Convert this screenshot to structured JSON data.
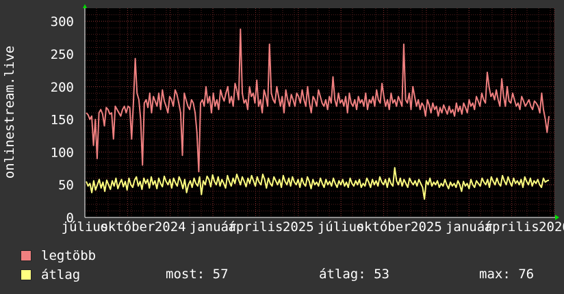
{
  "chart_data": {
    "type": "line",
    "ylabel": "onlinestream.live",
    "ylim": [
      0,
      320
    ],
    "yticks": [
      "0",
      "50",
      "100",
      "150",
      "200",
      "250",
      "300"
    ],
    "xticks": [
      "július",
      "október",
      "2024",
      "január",
      "április",
      "2025",
      "július",
      "október",
      "2025",
      "január",
      "április",
      "2026"
    ],
    "grid": true,
    "legend_placement": "bottom",
    "series": [
      {
        "name": "legtöbb",
        "color": "#f08080",
        "values": [
          160,
          157,
          150,
          155,
          110,
          150,
          90,
          160,
          165,
          158,
          140,
          168,
          165,
          158,
          160,
          120,
          170,
          165,
          160,
          155,
          165,
          170,
          160,
          170,
          168,
          120,
          175,
          243,
          190,
          180,
          150,
          80,
          175,
          180,
          168,
          190,
          160,
          185,
          178,
          170,
          190,
          165,
          195,
          178,
          170,
          160,
          185,
          180,
          170,
          195,
          188,
          175,
          160,
          95,
          190,
          180,
          170,
          165,
          180,
          175,
          160,
          130,
          70,
          175,
          180,
          170,
          200,
          175,
          185,
          160,
          190,
          170,
          180,
          165,
          195,
          185,
          178,
          190,
          200,
          175,
          185,
          170,
          205,
          195,
          180,
          288,
          190,
          175,
          180,
          165,
          200,
          185,
          190,
          175,
          210,
          170,
          180,
          160,
          195,
          185,
          170,
          265,
          190,
          180,
          175,
          200,
          185,
          170,
          185,
          160,
          195,
          180,
          170,
          188,
          180,
          170,
          190,
          185,
          175,
          195,
          180,
          170,
          200,
          175,
          160,
          185,
          180,
          170,
          195,
          185,
          175,
          170,
          180,
          165,
          185,
          175,
          215,
          180,
          170,
          190,
          175,
          180,
          170,
          185,
          160,
          190,
          175,
          170,
          180,
          165,
          185,
          175,
          180,
          170,
          190,
          165,
          180,
          175,
          185,
          170,
          195,
          180,
          175,
          205,
          185,
          170,
          180,
          165,
          190,
          175,
          180,
          170,
          185,
          178,
          170,
          265,
          180,
          175,
          190,
          165,
          200,
          185,
          170,
          180,
          165,
          175,
          170,
          155,
          180,
          172,
          160,
          175,
          165,
          170,
          155,
          168,
          160,
          172,
          165,
          158,
          170,
          160,
          165,
          155,
          175,
          162,
          170,
          158,
          175,
          168,
          160,
          180,
          170,
          175,
          165,
          185,
          178,
          170,
          190,
          180,
          175,
          222,
          200,
          185,
          190,
          180,
          195,
          180,
          170,
          212,
          185,
          170,
          200,
          178,
          175,
          190,
          180,
          170,
          175,
          165,
          185,
          178,
          170,
          175,
          180,
          170,
          165,
          178,
          175,
          170,
          160,
          190,
          165,
          150,
          130,
          155
        ]
      },
      {
        "name": "átlag",
        "color": "#ffff80",
        "values": [
          55,
          48,
          52,
          38,
          56,
          42,
          50,
          58,
          45,
          54,
          40,
          57,
          50,
          43,
          56,
          48,
          60,
          44,
          52,
          58,
          47,
          55,
          42,
          60,
          50,
          46,
          57,
          62,
          48,
          55,
          43,
          60,
          52,
          58,
          45,
          62,
          50,
          56,
          44,
          60,
          52,
          47,
          63,
          55,
          50,
          58,
          45,
          60,
          53,
          48,
          62,
          55,
          44,
          58,
          38,
          50,
          56,
          46,
          60,
          52,
          48,
          62,
          35,
          56,
          50,
          63,
          58,
          47,
          65,
          55,
          50,
          62,
          48,
          58,
          52,
          45,
          64,
          55,
          48,
          60,
          52,
          66,
          58,
          50,
          62,
          55,
          47,
          60,
          52,
          64,
          56,
          48,
          62,
          54,
          50,
          66,
          58,
          45,
          60,
          52,
          48,
          62,
          56,
          50,
          58,
          46,
          64,
          55,
          50,
          60,
          48,
          62,
          54,
          50,
          58,
          46,
          60,
          52,
          48,
          62,
          55,
          44,
          58,
          50,
          54,
          48,
          60,
          52,
          46,
          58,
          50,
          55,
          48,
          60,
          52,
          46,
          56,
          50,
          58,
          48,
          54,
          46,
          60,
          52,
          48,
          56,
          50,
          58,
          46,
          52,
          48,
          60,
          54,
          46,
          58,
          50,
          56,
          48,
          62,
          54,
          50,
          58,
          46,
          60,
          52,
          48,
          76,
          56,
          50,
          60,
          48,
          58,
          52,
          46,
          60,
          54,
          50,
          56,
          48,
          58,
          52,
          46,
          28,
          56,
          50,
          60,
          48,
          54,
          50,
          56,
          46,
          52,
          48,
          58,
          50,
          44,
          54,
          48,
          52,
          46,
          56,
          50,
          40,
          55,
          48,
          52,
          44,
          58,
          50,
          46,
          56,
          52,
          48,
          60,
          54,
          50,
          58,
          46,
          62,
          55,
          50,
          60,
          52,
          48,
          64,
          56,
          50,
          62,
          54,
          48,
          60,
          52,
          56,
          50,
          58,
          46,
          62,
          55,
          50,
          60,
          48,
          56,
          52,
          58,
          50,
          46,
          60,
          54,
          56,
          57
        ]
      }
    ],
    "stats": {
      "now_label": "most:",
      "now_value": "57",
      "avg_label": "átlag:",
      "avg_value": "53",
      "max_label": "max:",
      "max_value": "76"
    }
  }
}
